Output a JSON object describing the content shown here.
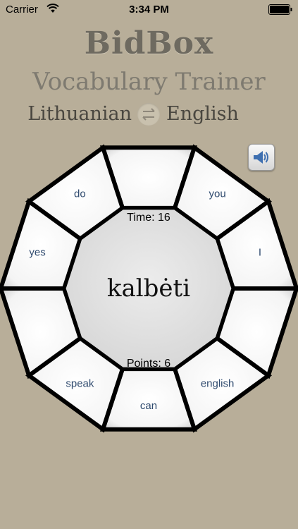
{
  "status": {
    "carrier": "Carrier",
    "time": "3:34 PM"
  },
  "app": {
    "title": "BidBox",
    "subtitle": "Vocabulary Trainer"
  },
  "languages": {
    "source": "Lithuanian",
    "target": "English"
  },
  "icons": {
    "swap": "swap-arrows-icon",
    "speaker": "speaker-icon"
  },
  "game": {
    "time_label": "Time: 16",
    "points_label": "Points: 6",
    "word": "kalbėti",
    "choices": [
      "",
      "you",
      "I",
      "",
      "english",
      "can",
      "speak",
      "",
      "yes",
      "do"
    ]
  },
  "colors": {
    "background": "#b8ae99",
    "word_text": "#2f4a6e"
  }
}
